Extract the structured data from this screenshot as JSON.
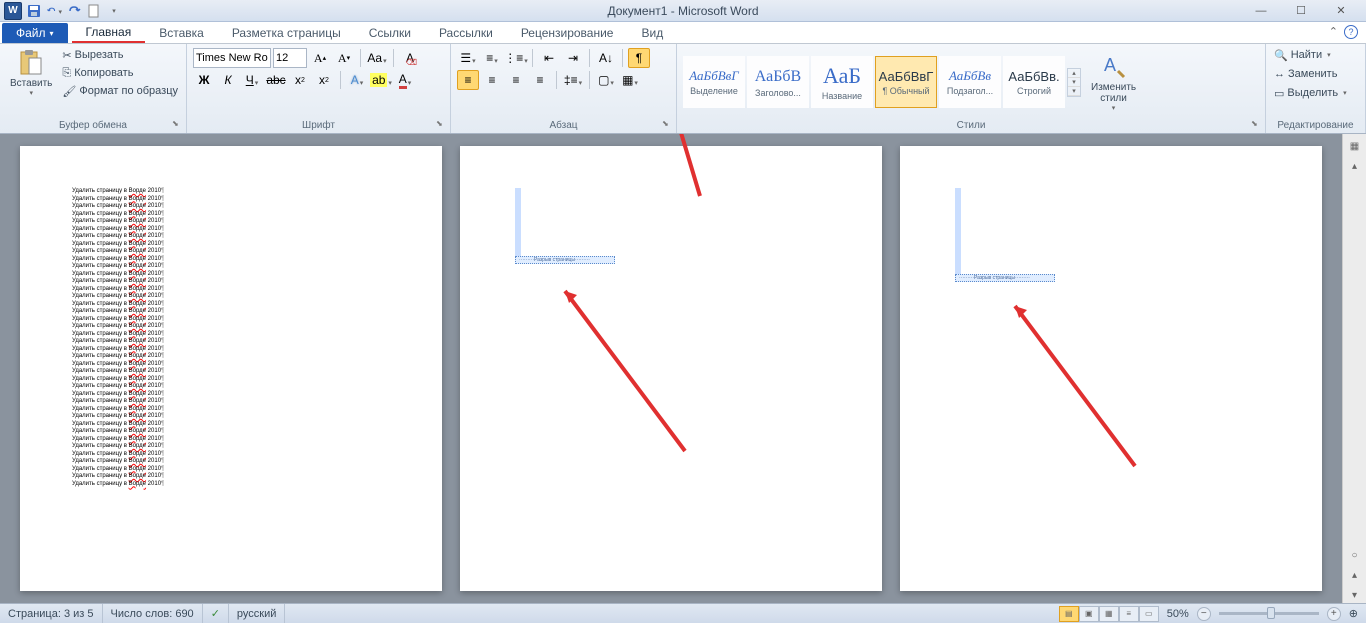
{
  "title": "Документ1 - Microsoft Word",
  "qat": {
    "save": "save",
    "undo": "undo",
    "redo": "redo",
    "new": "new"
  },
  "tabs": {
    "file": "Файл",
    "items": [
      "Главная",
      "Вставка",
      "Разметка страницы",
      "Ссылки",
      "Рассылки",
      "Рецензирование",
      "Вид"
    ],
    "active": 0
  },
  "clipboard": {
    "paste": "Вставить",
    "cut": "Вырезать",
    "copy": "Копировать",
    "format_painter": "Формат по образцу",
    "group": "Буфер обмена"
  },
  "font": {
    "name": "Times New Ro",
    "size": "12",
    "group": "Шрифт"
  },
  "paragraph": {
    "group": "Абзац"
  },
  "styles": {
    "group": "Стили",
    "change": "Изменить\nстили",
    "items": [
      {
        "preview": "АаБбВвГ",
        "name": "Выделение",
        "blue": true,
        "italic": true
      },
      {
        "preview": "АаБбВ",
        "name": "Заголово...",
        "blue": true,
        "big": true
      },
      {
        "preview": "АаБ",
        "name": "Название",
        "blue": true,
        "huge": true
      },
      {
        "preview": "АаБбВвГ",
        "name": "¶ Обычный",
        "active": true
      },
      {
        "preview": "АаБбВв",
        "name": "Подзагол...",
        "blue": true,
        "italic": true
      },
      {
        "preview": "АаБбВв.",
        "name": "Строгий"
      }
    ]
  },
  "editing": {
    "find": "Найти",
    "replace": "Заменить",
    "select": "Выделить",
    "group": "Редактирование"
  },
  "document": {
    "line_text_pre": "Удалить страницу в ",
    "line_text_wavy": "Ворде",
    "line_text_post": " 2010",
    "line_count": 40,
    "page_break_label": "Разрыв страницы"
  },
  "status": {
    "page": "Страница: 3 из 5",
    "words": "Число слов: 690",
    "lang": "русский",
    "zoom": "50%"
  }
}
